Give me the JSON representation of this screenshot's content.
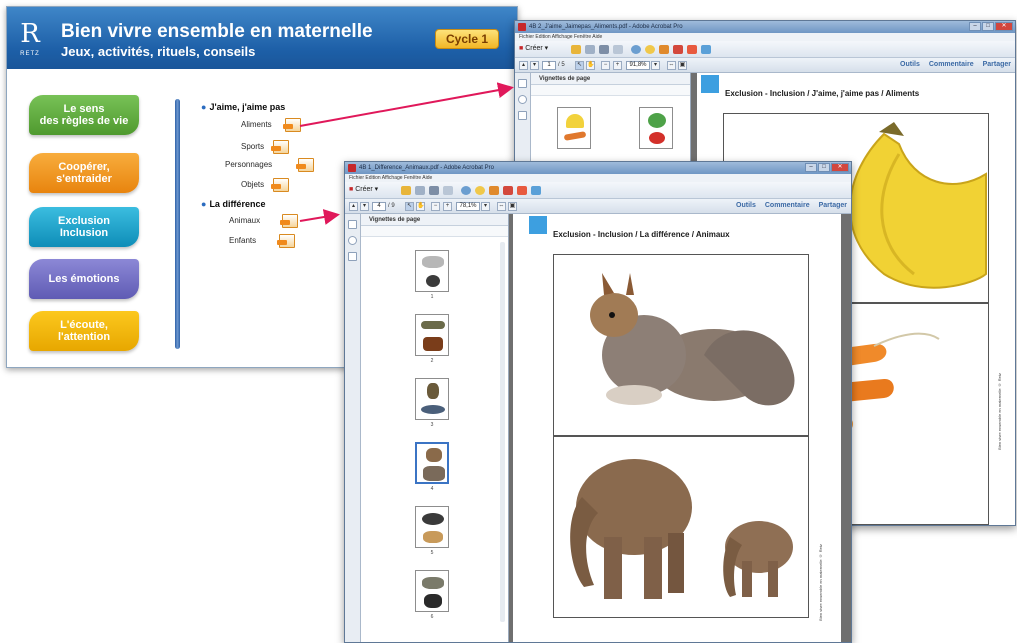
{
  "main_window": {
    "logo_letter": "R",
    "logo_text": "RETZ",
    "title": "Bien vivre ensemble en maternelle",
    "subtitle": "Jeux, activités, rituels, conseils",
    "cycle_badge": "Cycle 1",
    "categories": [
      {
        "line1": "Le sens",
        "line2": "des règles de vie",
        "color": "#5aa83a"
      },
      {
        "line1": "Coopérer,",
        "line2": "s'entraider",
        "color": "#f0901c"
      },
      {
        "line1": "Exclusion",
        "line2": "Inclusion",
        "color": "#16a3c8"
      },
      {
        "line1": "Les émotions",
        "line2": "",
        "color": "#7470c4"
      },
      {
        "line1": "L'écoute,",
        "line2": "l'attention",
        "color": "#f2b400"
      }
    ],
    "sections": [
      {
        "title": "J'aime, j'aime pas",
        "items": [
          "Aliments",
          "Sports",
          "Personnages",
          "Objets"
        ]
      },
      {
        "title": "La différence",
        "items": [
          "Animaux",
          "Enfants"
        ]
      }
    ]
  },
  "acrobat_back": {
    "title": "4B 2_J'aime_Jaimepas_Aliments.pdf - Adobe Acrobat Pro",
    "menu": "Fichier  Edition  Affichage  Fenêtre  Aide",
    "create_label": "Créer",
    "page_input": "1",
    "page_total": "/ 5",
    "zoom": "91,8%",
    "links": [
      "Outils",
      "Commentaire",
      "Partager"
    ],
    "panel_title": "Vignettes de page",
    "page_heading": "Exclusion - Inclusion / J'aime, j'aime pas / Aliments",
    "vertical_note": "Bien vivre ensemble en maternelle © Retz"
  },
  "acrobat_front": {
    "title": "4B 1_Difference_Animaux.pdf - Adobe Acrobat Pro",
    "menu": "Fichier  Edition  Affichage  Fenêtre  Aide",
    "create_label": "Créer",
    "page_input": "4",
    "page_total": "/ 9",
    "zoom": "78,1%",
    "links": [
      "Outils",
      "Commentaire",
      "Partager"
    ],
    "panel_title": "Vignettes de page",
    "page_heading": "Exclusion - Inclusion / La différence / Animaux",
    "thumb_numbers": [
      "1",
      "2",
      "3",
      "4",
      "5",
      "6"
    ],
    "vertical_note": "Bien vivre ensemble en maternelle © Retz"
  },
  "colors": {
    "arrow": "#e0185a",
    "accent_blue": "#1d5fa7"
  }
}
